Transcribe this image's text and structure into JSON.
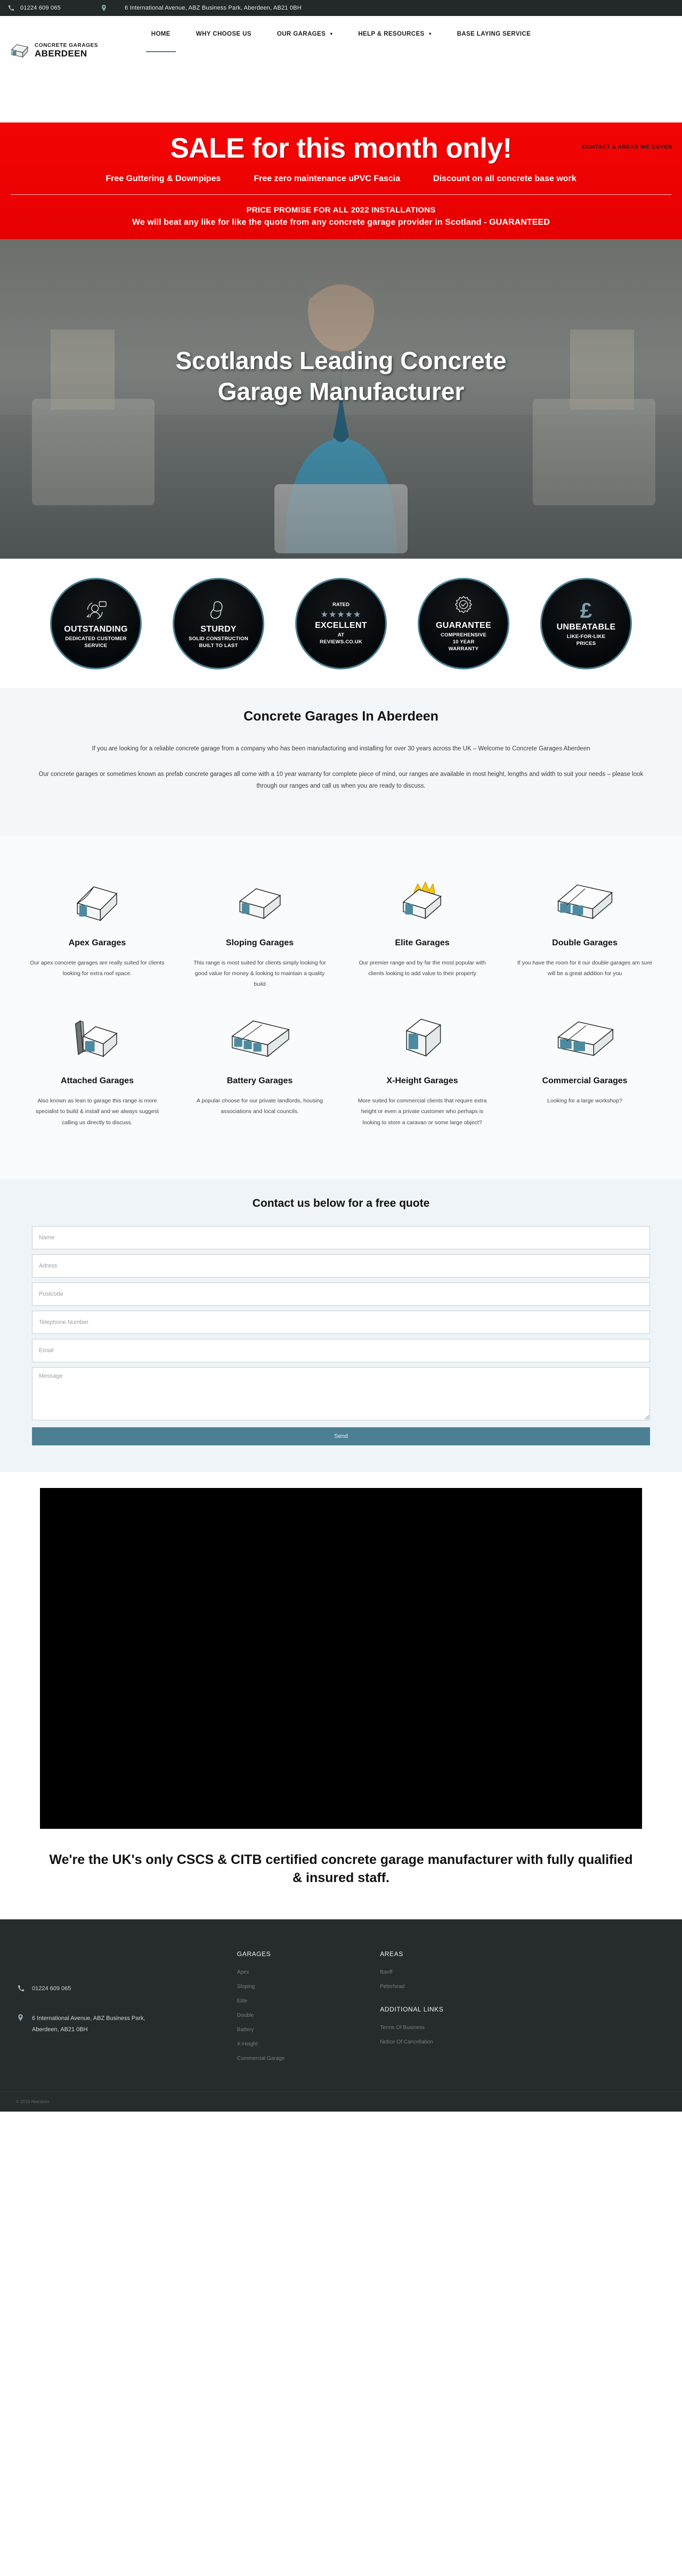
{
  "topbar": {
    "phone": "01224 609 065",
    "address": "6 International Avenue, ABZ Business Park, Aberdeen, AB21 0BH",
    "phone_icon": "phone-icon",
    "location_icon": "map-pin-icon"
  },
  "logo": {
    "line1": "CONCRETE GARAGES",
    "line2": "ABERDEEN"
  },
  "nav": {
    "items": [
      {
        "label": "HOME",
        "caret": "",
        "active": true
      },
      {
        "label": "WHY CHOOSE US",
        "caret": "",
        "active": false
      },
      {
        "label": "OUR GARAGES",
        "caret": "▾",
        "active": false
      },
      {
        "label": "HELP & RESOURCES",
        "caret": "▾",
        "active": false
      },
      {
        "label": "BASE LAYING SERVICE",
        "caret": "",
        "active": false
      }
    ],
    "sub_link": "CONTACT & AREAS WE COVER"
  },
  "sale": {
    "headline": "SALE for this month only!",
    "perks": [
      "Free Guttering & Downpipes",
      "Free zero maintenance uPVC Fascia",
      "Discount on all concrete base work"
    ],
    "promise_title": "PRICE PROMISE FOR ALL 2022 INSTALLATIONS",
    "promise_text": "We will beat any like for like the quote from any concrete garage provider in Scotland - GUARANTEED"
  },
  "hero": {
    "line1": "Scotlands Leading Concrete",
    "line2": "Garage Manufacturer"
  },
  "badges": [
    {
      "icon": "customer-service-icon",
      "title": "OUTSTANDING",
      "sub1": "DEDICATED CUSTOMER",
      "sub2": "SERVICE"
    },
    {
      "icon": "muscle-arm-icon",
      "title": "STURDY",
      "sub1": "SOLID CONSTRUCTION",
      "sub2": "BUILT TO LAST"
    },
    {
      "icon": "stars-icon",
      "rated": "RATED",
      "stars": "★★★★★",
      "title": "EXCELLENT",
      "sub1": "AT",
      "sub2": "REVIEWS.CO.UK"
    },
    {
      "icon": "guarantee-seal-icon",
      "title": "GUARANTEE",
      "sub1": "COMPREHENSIVE",
      "sub2": "10 YEAR",
      "sub3": "WARRANTY"
    },
    {
      "icon": "pound-icon",
      "pound": "£",
      "title": "UNBEATABLE",
      "sub1": "LIKE-FOR-LIKE",
      "sub2": "PRICES"
    }
  ],
  "intro": {
    "title": "Concrete Garages In Aberdeen",
    "para1": "If you are looking for a reliable concrete garage from a company who has been manufacturing and installing for over 30 years across the UK – Welcome to Concrete Garages Aberdeen",
    "para2": "Our concrete garages or sometimes known as prefab concrete garages all come with a 10 year warranty for complete piece of mind, our ranges are available in most height, lengths and width to suit your needs – please look through our ranges and call us when you are ready to discuss."
  },
  "products": [
    {
      "icon": "apex-garage-icon",
      "title": "Apex Garages",
      "desc": "Our apex concrete garages are really suited for clients looking for extra roof space."
    },
    {
      "icon": "sloping-garage-icon",
      "title": "Sloping Garages",
      "desc": "This range is most suited for clients simply looking for good value for money & looking to maintain a quality build"
    },
    {
      "icon": "elite-garage-icon",
      "title": "Elite Garages",
      "desc": "Our premier range and by far the most popular with clients looking to add value to their property"
    },
    {
      "icon": "double-garage-icon",
      "title": "Double Garages",
      "desc": "If you have the room for it our double garages am sure will be a great addition for you"
    },
    {
      "icon": "attached-garage-icon",
      "title": "Attached Garages",
      "desc": "Also known as lean to garage this range is more specialist to build & install and we always suggest calling us directly to discuss."
    },
    {
      "icon": "battery-garage-icon",
      "title": "Battery Garages",
      "desc": "A popular choose for our private landlords, housing associations and local councils."
    },
    {
      "icon": "xheight-garage-icon",
      "title": "X-Height Garages",
      "desc": "More suited for commercial clients that require extra height or even a private customer who perhaps is looking to store a caravan or some large object?"
    },
    {
      "icon": "commercial-garage-icon",
      "title": "Commercial Garages",
      "desc": "Looking for a large workshop?"
    }
  ],
  "contact": {
    "title": "Contact us below for a free quote",
    "fields": [
      {
        "name": "name",
        "placeholder": "Name"
      },
      {
        "name": "address",
        "placeholder": "Adress"
      },
      {
        "name": "postcode",
        "placeholder": "Postcode"
      },
      {
        "name": "telephone",
        "placeholder": "Telephone Number"
      },
      {
        "name": "email",
        "placeholder": "Email"
      }
    ],
    "message_placeholder": "Message",
    "send_label": "Send"
  },
  "cscs": "We're the UK's only CSCS & CITB certified concrete garage manufacturer with fully qualified & insured staff.",
  "footer": {
    "phone": "01224 609 065",
    "address_l1": "6 International Avenue, ABZ Business Park,",
    "address_l2": "Aberdeen, AB21 0BH",
    "garages_title": "GARAGES",
    "garages": [
      "Apex",
      "Sloping",
      "Elite",
      "Double",
      "Battery",
      "X-Height",
      "Commercial Garage"
    ],
    "areas_title": "AREAS",
    "areas": [
      "Banff",
      "Peterhead"
    ],
    "additional_title": "ADDITIONAL LINKS",
    "additional": [
      "Terms Of Business",
      "Notice Of Cancellation"
    ],
    "copyright": "© 2019 Aberdeen"
  },
  "colors": {
    "accent": "#4c7f93",
    "sale_red": "#e60000",
    "dark": "#262c2e"
  }
}
